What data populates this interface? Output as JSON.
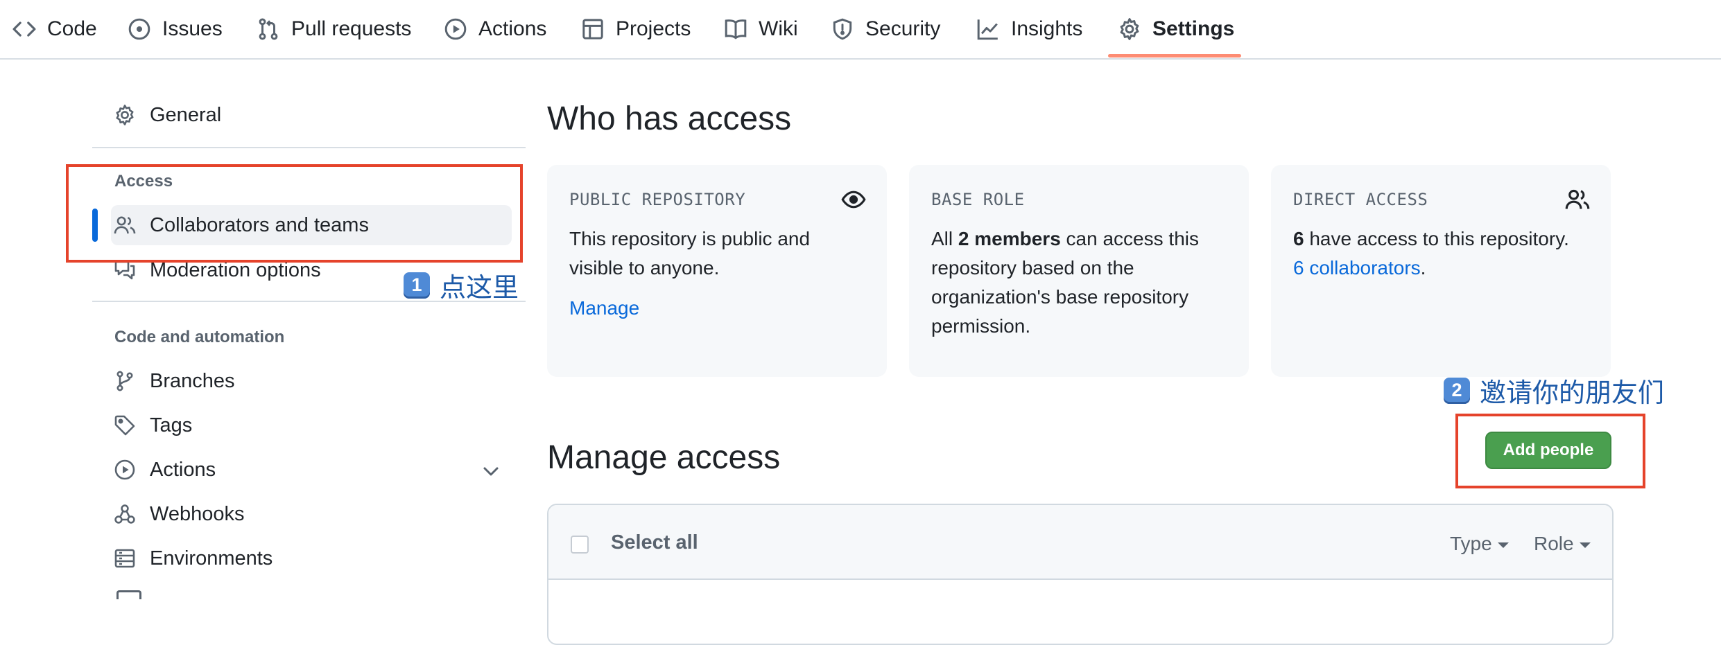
{
  "topnav": {
    "tabs": [
      {
        "label": "Code",
        "icon": "code-icon"
      },
      {
        "label": "Issues",
        "icon": "issue-opened-icon"
      },
      {
        "label": "Pull requests",
        "icon": "git-pull-request-icon"
      },
      {
        "label": "Actions",
        "icon": "play-icon"
      },
      {
        "label": "Projects",
        "icon": "table-icon"
      },
      {
        "label": "Wiki",
        "icon": "book-icon"
      },
      {
        "label": "Security",
        "icon": "shield-icon"
      },
      {
        "label": "Insights",
        "icon": "graph-icon"
      },
      {
        "label": "Settings",
        "icon": "gear-icon"
      }
    ],
    "active_tab": "Settings",
    "underline_color": "#fd8c73"
  },
  "sidebar": {
    "general": "General",
    "access_heading": "Access",
    "collaborators": "Collaborators and teams",
    "moderation": "Moderation options",
    "automation_heading": "Code and automation",
    "items": [
      {
        "label": "Branches",
        "icon": "git-branch-icon"
      },
      {
        "label": "Tags",
        "icon": "tag-icon"
      },
      {
        "label": "Actions",
        "icon": "play-icon"
      },
      {
        "label": "Webhooks",
        "icon": "webhook-icon"
      },
      {
        "label": "Environments",
        "icon": "server-icon"
      }
    ],
    "selected_color": "#0969da"
  },
  "annotations": {
    "step1_num": "1",
    "step1_text": "点这里",
    "step2_num": "2",
    "step2_text": "邀请你的朋友们",
    "box_color": "#e5432b"
  },
  "main": {
    "who_title": "Who has access",
    "cards": {
      "public": {
        "label": "PUBLIC REPOSITORY",
        "text": "This repository is public and visible to anyone.",
        "link": "Manage"
      },
      "base": {
        "label": "BASE ROLE",
        "pre": "All ",
        "bold": "2 members",
        "post": " can access this repository based on the organization's base repository permission."
      },
      "direct": {
        "label": "DIRECT ACCESS",
        "bold": "6",
        "text": " have access to this repository.",
        "link": "6 collaborators",
        "after": "."
      }
    },
    "manage_title": "Manage access",
    "add_button": "Add people",
    "table": {
      "select_all": "Select all",
      "type_filter": "Type",
      "role_filter": "Role"
    },
    "button_color": "#4a9f4f"
  }
}
